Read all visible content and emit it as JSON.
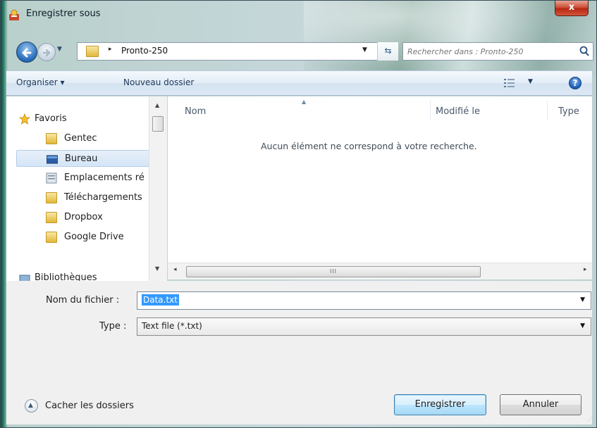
{
  "window": {
    "title": "Enregistrer sous",
    "close_label": "x"
  },
  "nav": {
    "breadcrumb_separator": "▸",
    "current_folder": "Pronto-250",
    "search_placeholder": "Rechercher dans : Pronto-250"
  },
  "toolbar": {
    "organize_label": "Organiser ▾",
    "new_folder_label": "Nouveau dossier",
    "help_label": "?"
  },
  "sidebar": {
    "items": [
      {
        "label": "Favoris",
        "icon": "star-icon"
      },
      {
        "label": "Gentec",
        "icon": "folder-icon"
      },
      {
        "label": "Bureau",
        "icon": "desktop-icon",
        "selected": true
      },
      {
        "label": "Emplacements ré",
        "icon": "recent-places-icon"
      },
      {
        "label": "Téléchargements",
        "icon": "downloads-folder-icon"
      },
      {
        "label": "Dropbox",
        "icon": "folder-icon"
      },
      {
        "label": "Google Drive",
        "icon": "google-drive-folder-icon"
      },
      {
        "label": "Bibliothèques",
        "icon": "libraries-icon"
      }
    ]
  },
  "file_list": {
    "columns": [
      "Nom",
      "Modifié le",
      "Type"
    ],
    "empty_message": "Aucun élément ne correspond à votre recherche."
  },
  "form": {
    "filename_label": "Nom du fichier :",
    "filename_value": "Data.txt",
    "type_label": "Type :",
    "type_value": "Text file (*.txt)"
  },
  "footer": {
    "hide_folders_label": "Cacher les dossiers",
    "save_label": "Enregistrer",
    "cancel_label": "Annuler"
  },
  "colors": {
    "selection": "#3399ff",
    "toolbar_text": "#1e395b",
    "default_button_border": "#3c7fb1"
  }
}
